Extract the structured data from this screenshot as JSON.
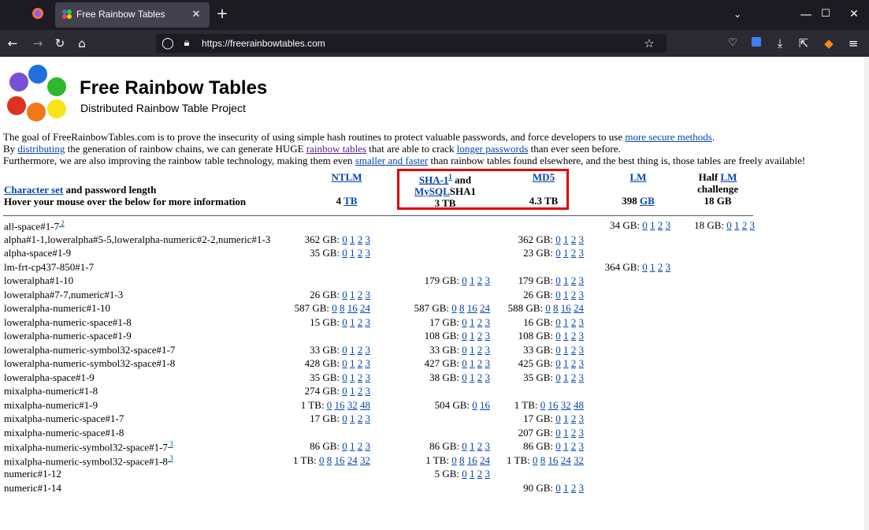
{
  "browser": {
    "tab_title": "Free Rainbow Tables",
    "url": "https://freerainbowtables.com"
  },
  "site": {
    "title": "Free Rainbow Tables",
    "subtitle": "Distributed Rainbow Table Project"
  },
  "intro": {
    "line1_pre": "The goal of FreeRainbowTables.com is to prove the insecurity of using simple hash routines to protect valuable passwords, and force developers to use ",
    "line1_link": "more secure methods",
    "line1_post": ".",
    "line2_a": "By ",
    "line2_link1": "distributing",
    "line2_b": " the generation of rainbow chains, we can generate HUGE ",
    "line2_link2": "rainbow tables",
    "line2_c": " that are able to crack ",
    "line2_link3": "longer passwords",
    "line2_d": " than ever seen before.",
    "line3_a": "Furthermore, we are also improving the rainbow table technology, making them even ",
    "line3_link": "smaller and faster",
    "line3_b": " than rainbow tables found elsewhere, and the best thing is, those tables are freely available!"
  },
  "table_header": {
    "charset_link": "Character set",
    "charset_rest": " and password length",
    "hover_note": "Hover your mouse over the below for more information",
    "ntlm": "NTLM",
    "ntlm_size": "4",
    "ntlm_unit": "TB",
    "sha1": "SHA-1",
    "sha1_sup": "1",
    "sha1_and": " and",
    "mysql": "MySQL",
    "mysql_rest": "SHA1",
    "sha1_size": "3 TB",
    "md5": "MD5",
    "md5_size": "4.3 TB",
    "lm": "LM",
    "lm_size": "398",
    "lm_unit": "GB",
    "half": "Half ",
    "half_lm": "LM",
    "challenge": "challenge",
    "half_size": "18 GB"
  },
  "rows": [
    {
      "label": "all-space#1-7",
      "sup": "2",
      "lm": {
        "size": "34 GB:",
        "links": [
          "0",
          "1",
          "2",
          "3"
        ]
      },
      "half": {
        "size": "18 GB:",
        "links": [
          "0",
          "1",
          "2",
          "3"
        ]
      }
    },
    {
      "label": "alpha#1-1,loweralpha#5-5,loweralpha-numeric#2-2,numeric#1-3",
      "ntlm": {
        "size": "362 GB:",
        "links": [
          "0",
          "1",
          "2",
          "3"
        ]
      },
      "md5": {
        "size": "362 GB:",
        "links": [
          "0",
          "1",
          "2",
          "3"
        ]
      }
    },
    {
      "label": "alpha-space#1-9",
      "ntlm": {
        "size": "35 GB:",
        "links": [
          "0",
          "1",
          "2",
          "3"
        ]
      },
      "md5": {
        "size": "23 GB:",
        "links": [
          "0",
          "1",
          "2",
          "3"
        ]
      }
    },
    {
      "label": "lm-frt-cp437-850#1-7",
      "lm": {
        "size": "364 GB:",
        "links": [
          "0",
          "1",
          "2",
          "3"
        ]
      }
    },
    {
      "label": "loweralpha#1-10",
      "sha1": {
        "size": "179 GB:",
        "links": [
          "0",
          "1",
          "2",
          "3"
        ]
      },
      "md5": {
        "size": "179 GB:",
        "links": [
          "0",
          "1",
          "2",
          "3"
        ]
      }
    },
    {
      "label": "loweralpha#7-7,numeric#1-3",
      "ntlm": {
        "size": "26 GB:",
        "links": [
          "0",
          "1",
          "2",
          "3"
        ]
      },
      "md5": {
        "size": "26 GB:",
        "links": [
          "0",
          "1",
          "2",
          "3"
        ]
      }
    },
    {
      "label": "loweralpha-numeric#1-10",
      "ntlm": {
        "size": "587 GB:",
        "links": [
          "0",
          "8",
          "16",
          "24"
        ]
      },
      "sha1": {
        "size": "587 GB:",
        "links": [
          "0",
          "8",
          "16",
          "24"
        ]
      },
      "md5": {
        "size": "588 GB:",
        "links": [
          "0",
          "8",
          "16",
          "24"
        ]
      }
    },
    {
      "label": "loweralpha-numeric-space#1-8",
      "ntlm": {
        "size": "15 GB:",
        "links": [
          "0",
          "1",
          "2",
          "3"
        ]
      },
      "sha1": {
        "size": "17 GB:",
        "links": [
          "0",
          "1",
          "2",
          "3"
        ]
      },
      "md5": {
        "size": "16 GB:",
        "links": [
          "0",
          "1",
          "2",
          "3"
        ]
      }
    },
    {
      "label": "loweralpha-numeric-space#1-9",
      "sha1": {
        "size": "108 GB:",
        "links": [
          "0",
          "1",
          "2",
          "3"
        ]
      },
      "md5": {
        "size": "108 GB:",
        "links": [
          "0",
          "1",
          "2",
          "3"
        ]
      }
    },
    {
      "label": "loweralpha-numeric-symbol32-space#1-7",
      "ntlm": {
        "size": "33 GB:",
        "links": [
          "0",
          "1",
          "2",
          "3"
        ]
      },
      "sha1": {
        "size": "33 GB:",
        "links": [
          "0",
          "1",
          "2",
          "3"
        ]
      },
      "md5": {
        "size": "33 GB:",
        "links": [
          "0",
          "1",
          "2",
          "3"
        ]
      }
    },
    {
      "label": "loweralpha-numeric-symbol32-space#1-8",
      "ntlm": {
        "size": "428 GB:",
        "links": [
          "0",
          "1",
          "2",
          "3"
        ]
      },
      "sha1": {
        "size": "427 GB:",
        "links": [
          "0",
          "1",
          "2",
          "3"
        ]
      },
      "md5": {
        "size": "425 GB:",
        "links": [
          "0",
          "1",
          "2",
          "3"
        ]
      }
    },
    {
      "label": "loweralpha-space#1-9",
      "ntlm": {
        "size": "35 GB:",
        "links": [
          "0",
          "1",
          "2",
          "3"
        ]
      },
      "sha1": {
        "size": "38 GB:",
        "links": [
          "0",
          "1",
          "2",
          "3"
        ]
      },
      "md5": {
        "size": "35 GB:",
        "links": [
          "0",
          "1",
          "2",
          "3"
        ]
      }
    },
    {
      "label": "mixalpha-numeric#1-8",
      "ntlm": {
        "size": "274 GB:",
        "links": [
          "0",
          "1",
          "2",
          "3"
        ]
      }
    },
    {
      "label": "mixalpha-numeric#1-9",
      "ntlm": {
        "size": "1 TB:",
        "links": [
          "0",
          "16",
          "32",
          "48"
        ]
      },
      "sha1": {
        "size": "504 GB:",
        "links": [
          "0",
          "16"
        ]
      },
      "md5": {
        "size": "1 TB:",
        "links": [
          "0",
          "16",
          "32",
          "48"
        ]
      }
    },
    {
      "label": "mixalpha-numeric-space#1-7",
      "ntlm": {
        "size": "17 GB:",
        "links": [
          "0",
          "1",
          "2",
          "3"
        ]
      },
      "md5": {
        "size": "17 GB:",
        "links": [
          "0",
          "1",
          "2",
          "3"
        ]
      }
    },
    {
      "label": "mixalpha-numeric-space#1-8",
      "md5": {
        "size": "207 GB:",
        "links": [
          "0",
          "1",
          "2",
          "3"
        ]
      }
    },
    {
      "label": "mixalpha-numeric-symbol32-space#1-7",
      "sup": "3",
      "ntlm": {
        "size": "86 GB:",
        "links": [
          "0",
          "1",
          "2",
          "3"
        ]
      },
      "sha1": {
        "size": "86 GB:",
        "links": [
          "0",
          "1",
          "2",
          "3"
        ]
      },
      "md5": {
        "size": "86 GB:",
        "links": [
          "0",
          "1",
          "2",
          "3"
        ]
      }
    },
    {
      "label": "mixalpha-numeric-symbol32-space#1-8",
      "sup": "3",
      "ntlm": {
        "size": "1 TB:",
        "links": [
          "0",
          "8",
          "16",
          "24",
          "32"
        ]
      },
      "sha1": {
        "size": "1 TB:",
        "links": [
          "0",
          "8",
          "16",
          "24"
        ]
      },
      "md5": {
        "size": "1 TB:",
        "links": [
          "0",
          "8",
          "16",
          "24",
          "32"
        ]
      }
    },
    {
      "label": "numeric#1-12",
      "sha1": {
        "size": "5 GB:",
        "links": [
          "0",
          "1",
          "2",
          "3"
        ]
      }
    },
    {
      "label": "numeric#1-14",
      "md5": {
        "size": "90 GB:",
        "links": [
          "0",
          "1",
          "2",
          "3"
        ]
      }
    }
  ]
}
